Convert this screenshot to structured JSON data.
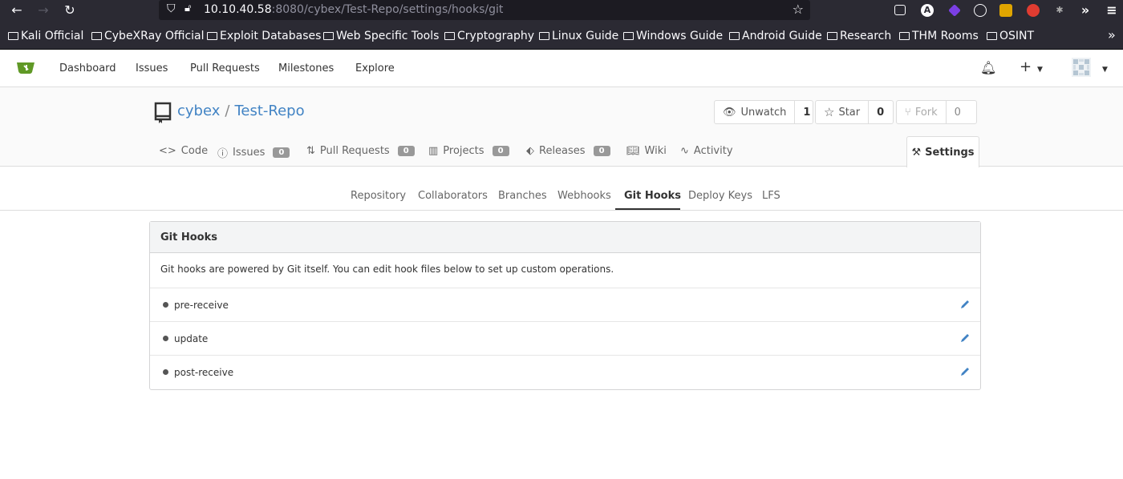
{
  "browser": {
    "url_host": "10.10.40.58",
    "url_rest": ":8080/cybex/Test-Repo/settings/hooks/git",
    "bookmarks": [
      "Kali Official",
      "CybeXRay Official",
      "Exploit Databases",
      "Web Specific Tools",
      "Cryptography",
      "Linux Guide",
      "Windows Guide",
      "Android Guide",
      "Research",
      "THM Rooms",
      "OSINT"
    ],
    "more_bookmarks": "»"
  },
  "top_nav": {
    "items": [
      "Dashboard",
      "Issues",
      "Pull Requests",
      "Milestones",
      "Explore"
    ]
  },
  "repo": {
    "owner": "cybex",
    "separator": "/",
    "name": "Test-Repo",
    "watch": {
      "label": "Unwatch",
      "count": "1"
    },
    "star": {
      "label": "Star",
      "count": "0"
    },
    "fork": {
      "label": "Fork",
      "count": "0"
    },
    "tabs": [
      {
        "label": "Code",
        "icon": "code-icon"
      },
      {
        "label": "Issues",
        "icon": "issue-icon",
        "badge": "0"
      },
      {
        "label": "Pull Requests",
        "icon": "pull-request-icon",
        "badge": "0"
      },
      {
        "label": "Projects",
        "icon": "project-icon",
        "badge": "0"
      },
      {
        "label": "Releases",
        "icon": "tag-icon",
        "badge": "0"
      },
      {
        "label": "Wiki",
        "icon": "book-icon"
      },
      {
        "label": "Activity",
        "icon": "pulse-icon"
      }
    ],
    "settings_tab": "Settings"
  },
  "settings_nav": {
    "items": [
      "Repository",
      "Collaborators",
      "Branches",
      "Webhooks",
      "Git Hooks",
      "Deploy Keys",
      "LFS"
    ],
    "active": "Git Hooks"
  },
  "git_hooks": {
    "title": "Git Hooks",
    "description": "Git hooks are powered by Git itself. You can edit hook files below to set up custom operations.",
    "hooks": [
      "pre-receive",
      "update",
      "post-receive"
    ]
  },
  "colors": {
    "link": "#4183c4",
    "logo_green": "#609926",
    "browser_bg": "#2b2a33"
  }
}
